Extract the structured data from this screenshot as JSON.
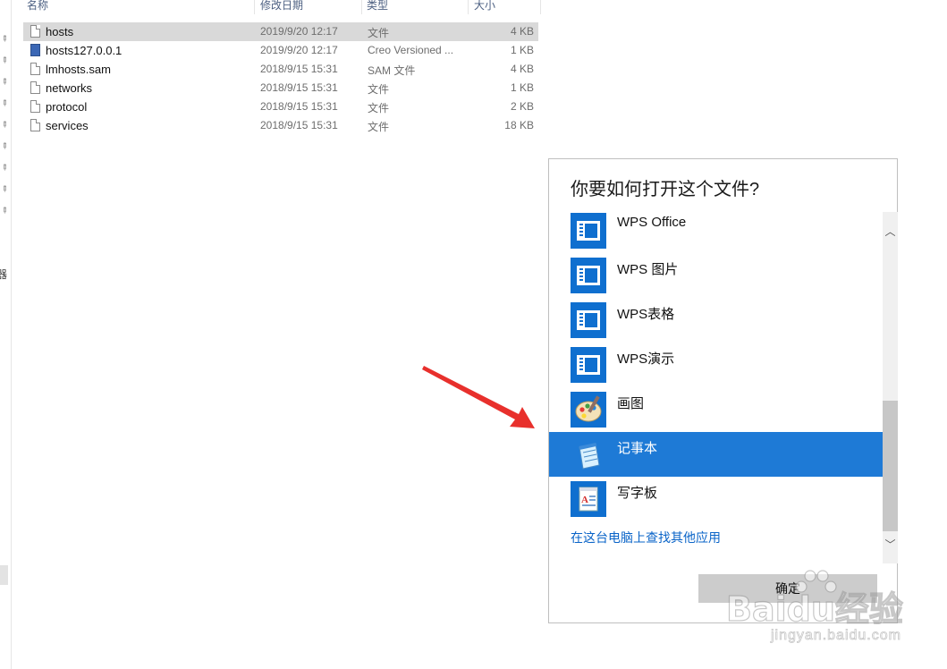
{
  "explorer": {
    "nav_char": "器",
    "columns": {
      "name": "名称",
      "date": "修改日期",
      "type": "类型",
      "size": "大小"
    },
    "files": [
      {
        "name": "hosts",
        "date": "2019/9/20 12:17",
        "type": "文件",
        "size": "4 KB",
        "selected": true,
        "icon": "file-icon"
      },
      {
        "name": "hosts127.0.0.1",
        "date": "2019/9/20 12:17",
        "type": "Creo Versioned ...",
        "size": "1 KB",
        "selected": false,
        "icon": "app-file-icon"
      },
      {
        "name": "lmhosts.sam",
        "date": "2018/9/15 15:31",
        "type": "SAM 文件",
        "size": "4 KB",
        "selected": false,
        "icon": "file-icon"
      },
      {
        "name": "networks",
        "date": "2018/9/15 15:31",
        "type": "文件",
        "size": "1 KB",
        "selected": false,
        "icon": "file-icon"
      },
      {
        "name": "protocol",
        "date": "2018/9/15 15:31",
        "type": "文件",
        "size": "2 KB",
        "selected": false,
        "icon": "file-icon"
      },
      {
        "name": "services",
        "date": "2018/9/15 15:31",
        "type": "文件",
        "size": "18 KB",
        "selected": false,
        "icon": "file-icon"
      }
    ]
  },
  "dialog": {
    "title": "你要如何打开这个文件?",
    "apps": [
      {
        "label": "WPS Office",
        "icon": "wps-icon",
        "selected": false
      },
      {
        "label": "WPS 图片",
        "icon": "wps-icon",
        "selected": false
      },
      {
        "label": "WPS表格",
        "icon": "wps-icon",
        "selected": false
      },
      {
        "label": "WPS演示",
        "icon": "wps-icon",
        "selected": false
      },
      {
        "label": "画图",
        "icon": "paint-icon",
        "selected": false
      },
      {
        "label": "记事本",
        "icon": "notepad-icon",
        "selected": true
      },
      {
        "label": "写字板",
        "icon": "wordpad-icon",
        "selected": false
      }
    ],
    "more_apps_link": "在这台电脑上查找其他应用",
    "ok_button": "确定"
  },
  "colors": {
    "selection_blue": "#1e7ad6",
    "tile_blue": "#0f6fcf",
    "arrow_red": "#e8302c",
    "link_blue": "#0a64c8"
  },
  "watermark": {
    "main": "Baidu经验",
    "sub": "jingyan.baidu.com"
  }
}
